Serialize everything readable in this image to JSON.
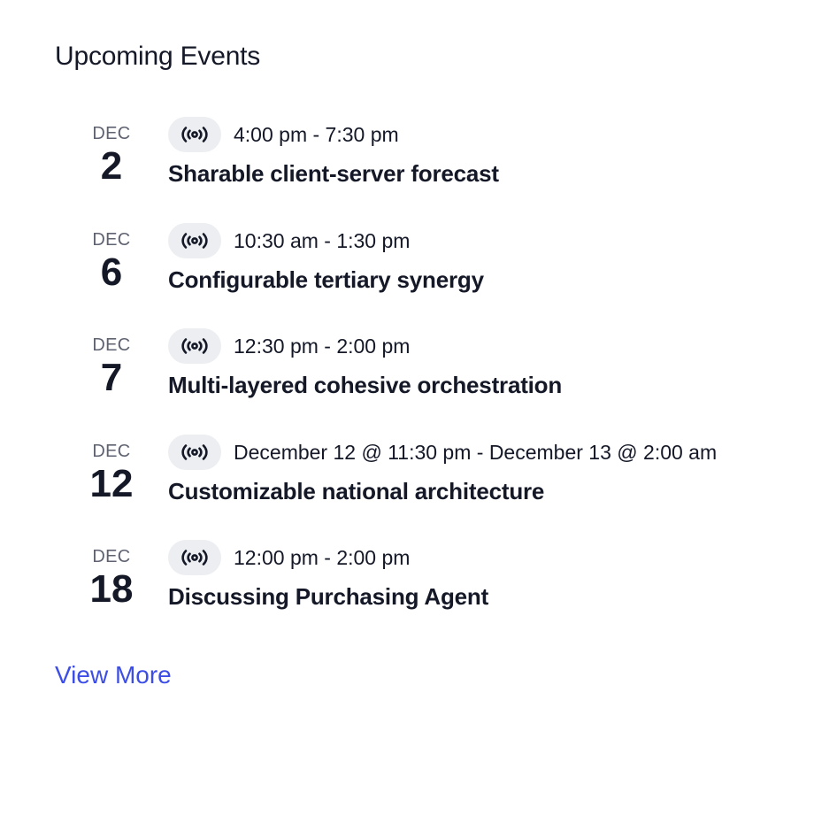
{
  "widget": {
    "title": "Upcoming Events",
    "view_more_label": "View More",
    "accent_color": "#3d4ee6",
    "badge_icon": "broadcast-icon"
  },
  "events": [
    {
      "month": "DEC",
      "day": "2",
      "time": "4:00 pm - 7:30 pm",
      "title": "Sharable client-server forecast"
    },
    {
      "month": "DEC",
      "day": "6",
      "time": "10:30 am - 1:30 pm",
      "title": "Configurable tertiary synergy"
    },
    {
      "month": "DEC",
      "day": "7",
      "time": "12:30 pm - 2:00 pm",
      "title": "Multi-layered cohesive orchestration"
    },
    {
      "month": "DEC",
      "day": "12",
      "time": "December 12 @ 11:30 pm - December 13 @ 2:00 am",
      "title": "Customizable national architecture"
    },
    {
      "month": "DEC",
      "day": "18",
      "time": "12:00 pm - 2:00 pm",
      "title": "Discussing Purchasing Agent"
    }
  ]
}
